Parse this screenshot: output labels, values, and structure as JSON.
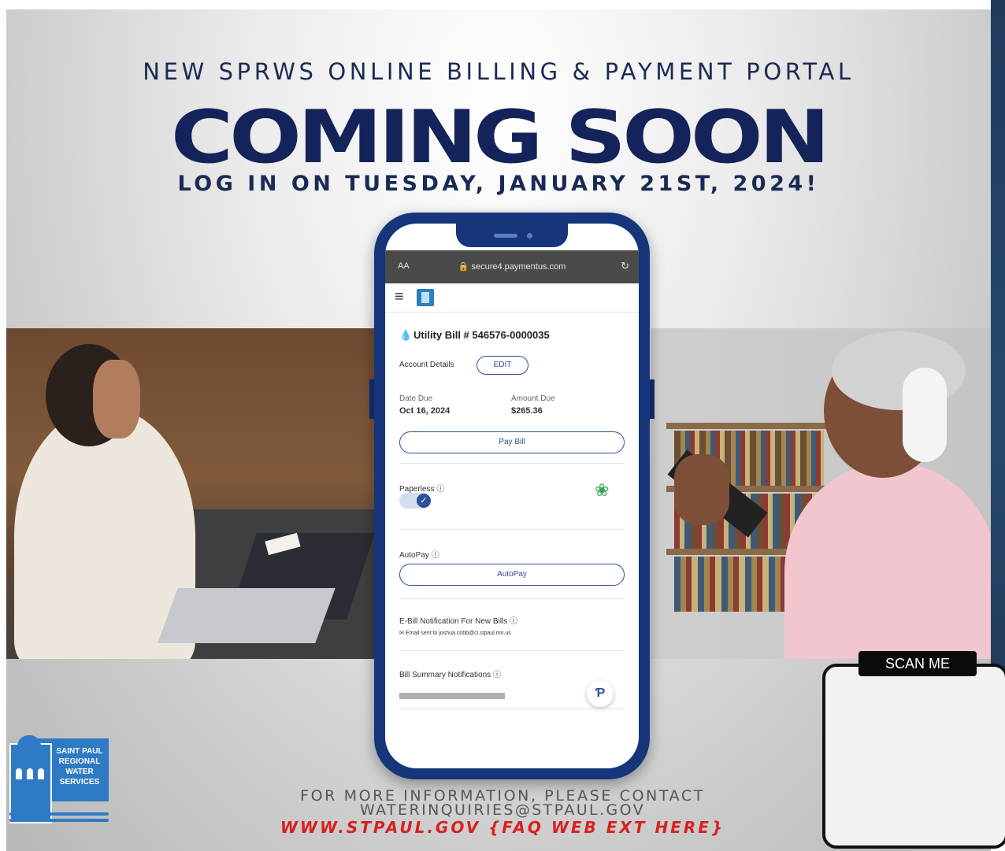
{
  "header": {
    "headline": "NEW SPRWS ONLINE BILLING & PAYMENT PORTAL",
    "coming_soon": "COMING SOON",
    "login_date": "LOG IN ON TUESDAY, JANUARY 21ST, 2024!"
  },
  "phone": {
    "browser": {
      "text_size": "AA",
      "url": "secure4.paymentus.com"
    },
    "bill": {
      "title": "Utility Bill # 546576-0000035",
      "account_details_label": "Account Details",
      "edit_label": "EDIT",
      "date_due_label": "Date Due",
      "date_due_value": "Oct 16, 2024",
      "amount_due_label": "Amount Due",
      "amount_due_value": "$265.36",
      "pay_bill_label": "Pay Bill",
      "paperless_label": "Paperless",
      "autopay_label": "AutoPay",
      "autopay_button": "AutoPay",
      "ebill_label": "E-Bill Notification For New Bills",
      "ebill_email": "Email  sent to joshua.cobb@ci.stpaul.mn.us",
      "bill_summary_label": "Bill Summary Notifications"
    }
  },
  "logo": {
    "lines": [
      "SAINT PAUL",
      "REGIONAL",
      "WATER",
      "SERVICES"
    ]
  },
  "footer": {
    "line1": "FOR MORE INFORMATION, PLEASE CONTACT",
    "line2": "WATERINQUIRIES@STPAUL.GOV",
    "line3": "WWW.STPAUL.GOV {FAQ WEB EXT HERE}"
  },
  "qr": {
    "label": "SCAN ME"
  },
  "colors": {
    "navy": "#14245a",
    "phone_blue": "#16357a",
    "link_red": "#d8201f",
    "logo_blue": "#2f7ac4"
  }
}
